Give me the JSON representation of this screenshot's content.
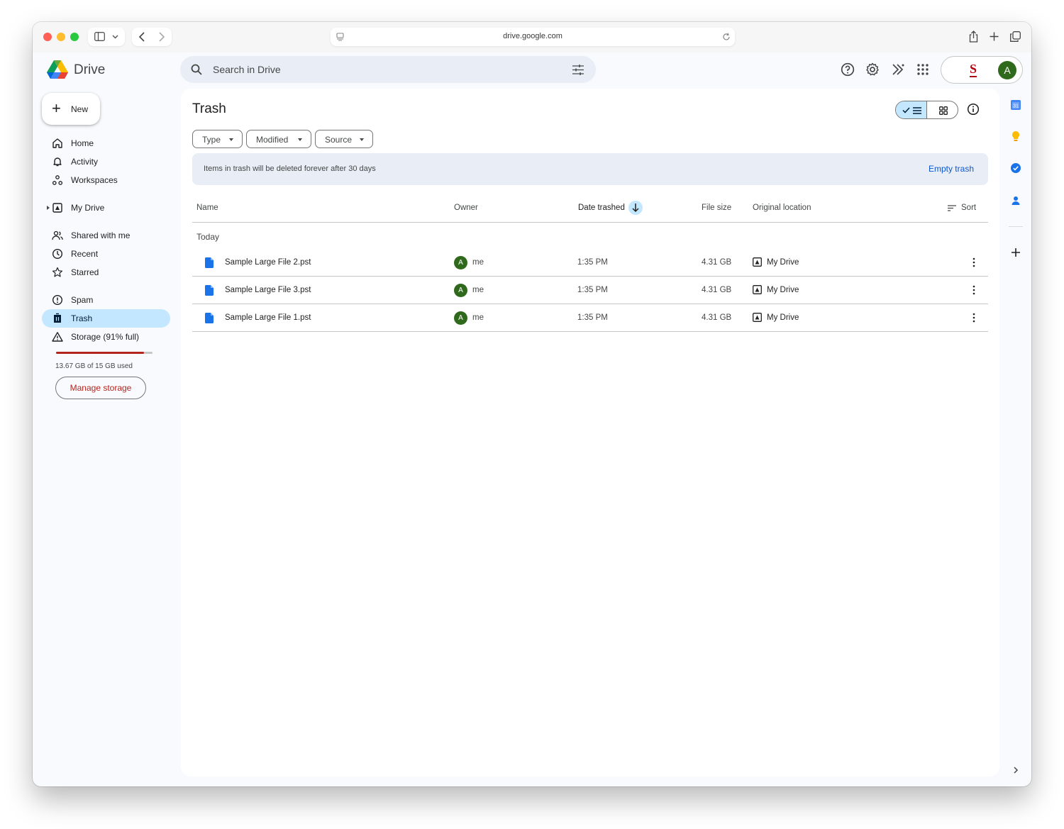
{
  "browser": {
    "url": "drive.google.com"
  },
  "app": {
    "name": "Drive"
  },
  "search": {
    "placeholder": "Search in Drive"
  },
  "header": {
    "icons": [
      "help-icon",
      "settings-icon",
      "gemini-icon",
      "apps-grid-icon"
    ],
    "account_initial": "A"
  },
  "sidebar": {
    "new_label": "New",
    "items": [
      {
        "label": "Home",
        "icon": "home-icon"
      },
      {
        "label": "Activity",
        "icon": "bell-icon"
      },
      {
        "label": "Workspaces",
        "icon": "workspaces-icon"
      },
      {
        "label": "My Drive",
        "icon": "my-drive-icon"
      },
      {
        "label": "Shared with me",
        "icon": "shared-icon"
      },
      {
        "label": "Recent",
        "icon": "clock-icon"
      },
      {
        "label": "Starred",
        "icon": "star-icon"
      },
      {
        "label": "Spam",
        "icon": "spam-icon"
      },
      {
        "label": "Trash",
        "icon": "trash-icon",
        "active": true
      },
      {
        "label": "Storage (91% full)",
        "icon": "warning-icon"
      }
    ],
    "storage": {
      "used_fraction": 0.91,
      "text": "13.67 GB of 15 GB used",
      "manage_label": "Manage storage"
    }
  },
  "main": {
    "title": "Trash",
    "filters": [
      "Type",
      "Modified",
      "Source"
    ],
    "banner": {
      "text": "Items in trash will be deleted forever after 30 days",
      "action": "Empty trash"
    },
    "columns": {
      "name": "Name",
      "owner": "Owner",
      "date": "Date trashed",
      "size": "File size",
      "location": "Original location",
      "sort": "Sort"
    },
    "group": "Today",
    "rows": [
      {
        "name": "Sample Large File 2.pst",
        "owner_initial": "A",
        "owner": "me",
        "date": "1:35 PM",
        "size": "4.31 GB",
        "location": "My Drive"
      },
      {
        "name": "Sample Large File 3.pst",
        "owner_initial": "A",
        "owner": "me",
        "date": "1:35 PM",
        "size": "4.31 GB",
        "location": "My Drive"
      },
      {
        "name": "Sample Large File 1.pst",
        "owner_initial": "A",
        "owner": "me",
        "date": "1:35 PM",
        "size": "4.31 GB",
        "location": "My Drive"
      }
    ]
  },
  "right_rail": {
    "calendar_day": "31",
    "icons": [
      "calendar-icon",
      "keep-icon",
      "tasks-icon",
      "contacts-icon",
      "add-icon",
      "chevron-right-icon"
    ]
  },
  "colors": {
    "accent": "#0b57d0",
    "active_nav": "#c2e7ff",
    "storage_warning": "#b3261e",
    "avatar": "#2f6a1c"
  }
}
